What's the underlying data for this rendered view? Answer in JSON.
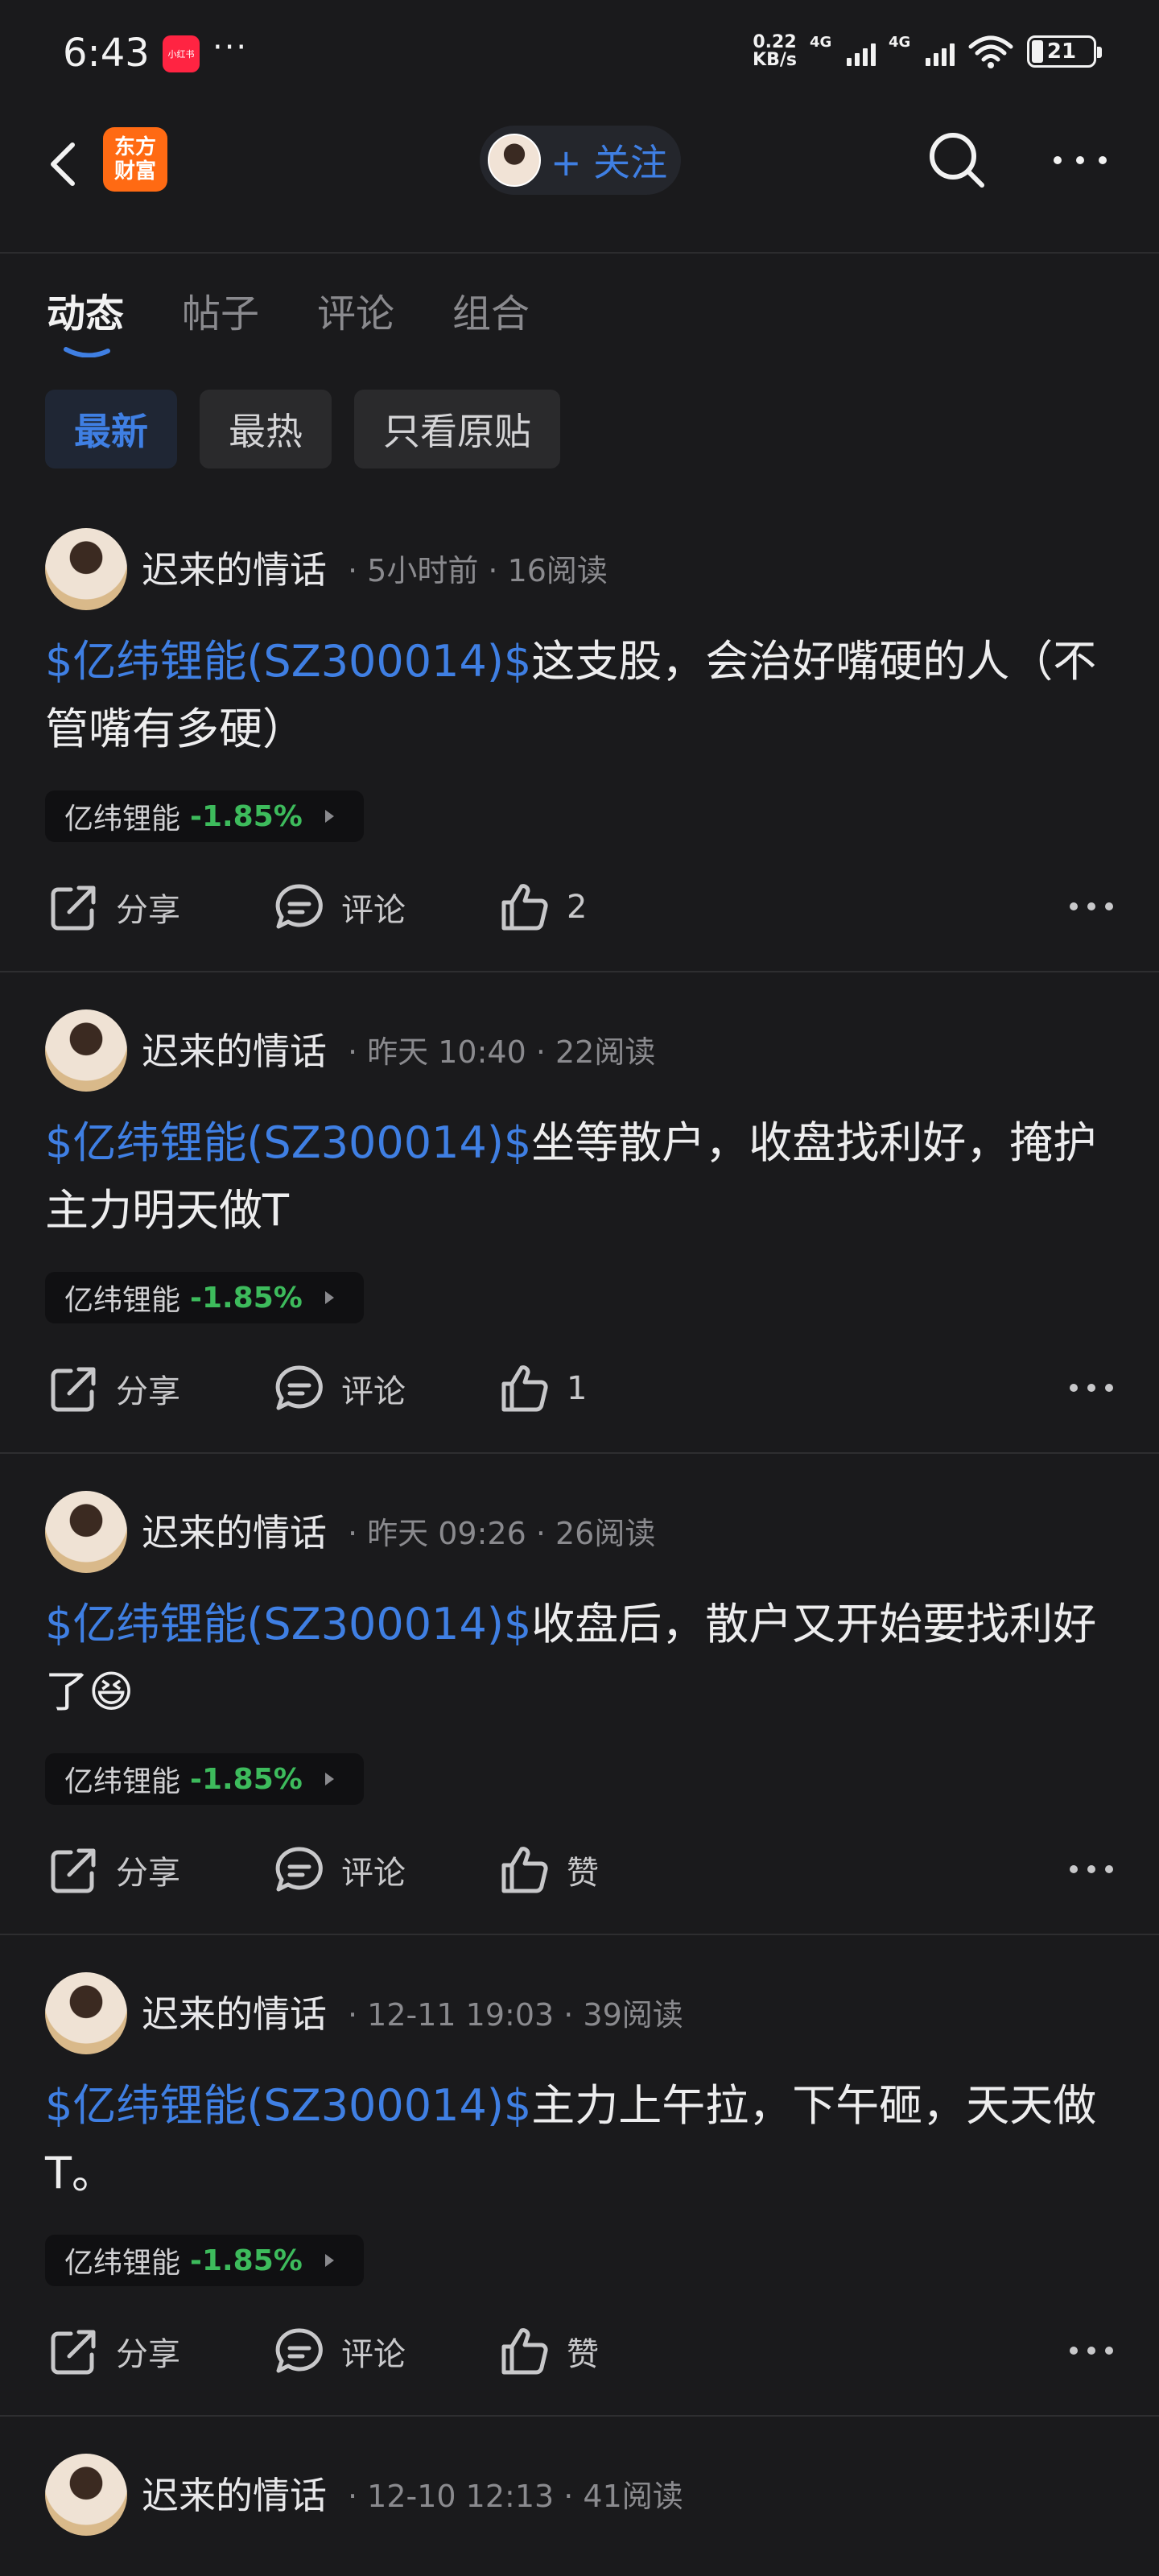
{
  "status_bar": {
    "time": "6:43",
    "app_icon_label": "小红书",
    "more": "···",
    "net_speed_value": "0.22",
    "net_speed_unit": "KB/s",
    "network_1": "4G",
    "network_2": "4G",
    "battery": "21"
  },
  "header": {
    "brand_line1": "东方",
    "brand_line2": "财富",
    "follow_label": "+ 关注"
  },
  "tabs": [
    {
      "label": "动态",
      "active": true
    },
    {
      "label": "帖子",
      "active": false
    },
    {
      "label": "评论",
      "active": false
    },
    {
      "label": "组合",
      "active": false
    }
  ],
  "filters": [
    {
      "label": "最新",
      "active": true
    },
    {
      "label": "最热",
      "active": false
    },
    {
      "label": "只看原贴",
      "active": false
    }
  ],
  "posts": [
    {
      "author": "迟来的情话",
      "meta": "· 5小时前 · 16阅读",
      "stock_link": "$亿纬锂能(SZ300014)$",
      "text": "这支股，会治好嘴硬的人（不管嘴有多硬）",
      "tag_name": "亿纬锂能",
      "tag_change": "-1.85%",
      "share": "分享",
      "comment": "评论",
      "like": "2"
    },
    {
      "author": "迟来的情话",
      "meta": "· 昨天 10:40 · 22阅读",
      "stock_link": "$亿纬锂能(SZ300014)$",
      "text": "坐等散户，收盘找利好，掩护主力明天做T",
      "tag_name": "亿纬锂能",
      "tag_change": "-1.85%",
      "share": "分享",
      "comment": "评论",
      "like": "1"
    },
    {
      "author": "迟来的情话",
      "meta": "· 昨天 09:26 · 26阅读",
      "stock_link": "$亿纬锂能(SZ300014)$",
      "text": "收盘后，散户又开始要找利好了😆",
      "tag_name": "亿纬锂能",
      "tag_change": "-1.85%",
      "share": "分享",
      "comment": "评论",
      "like": "赞"
    },
    {
      "author": "迟来的情话",
      "meta": "· 12-11 19:03 · 39阅读",
      "stock_link": "$亿纬锂能(SZ300014)$",
      "text": "主力上午拉，下午砸，天天做T。",
      "tag_name": "亿纬锂能",
      "tag_change": "-1.85%",
      "share": "分享",
      "comment": "评论",
      "like": "赞"
    },
    {
      "author": "迟来的情话",
      "meta": "· 12-10 12:13 · 41阅读"
    }
  ]
}
